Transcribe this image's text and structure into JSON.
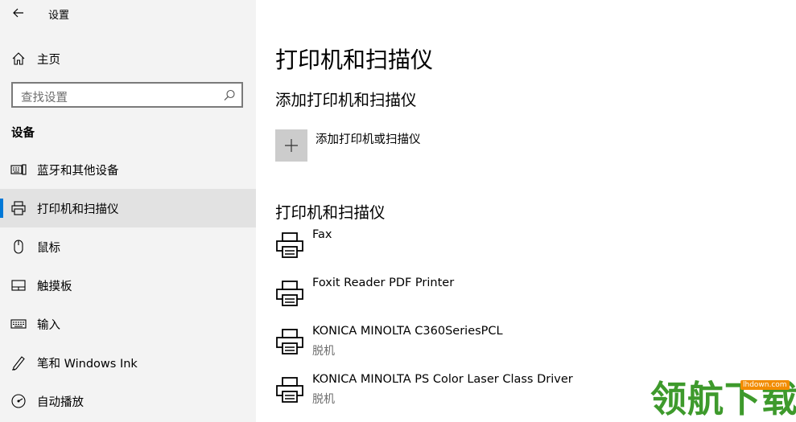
{
  "window": {
    "title": "设置"
  },
  "sidebar": {
    "home_label": "主页",
    "search_placeholder": "查找设置",
    "section_label": "设备",
    "items": [
      {
        "label": "蓝牙和其他设备",
        "icon": "bluetooth-devices-icon"
      },
      {
        "label": "打印机和扫描仪",
        "icon": "printer-icon",
        "active": true
      },
      {
        "label": "鼠标",
        "icon": "mouse-icon"
      },
      {
        "label": "触摸板",
        "icon": "touchpad-icon"
      },
      {
        "label": "输入",
        "icon": "keyboard-icon"
      },
      {
        "label": "笔和 Windows Ink",
        "icon": "pen-icon"
      },
      {
        "label": "自动播放",
        "icon": "autoplay-icon"
      }
    ]
  },
  "main": {
    "title": "打印机和扫描仪",
    "add_section_heading": "添加打印机和扫描仪",
    "add_button_label": "添加打印机或扫描仪",
    "list_heading": "打印机和扫描仪",
    "printers": [
      {
        "name": "Fax",
        "status": ""
      },
      {
        "name": "Foxit Reader PDF Printer",
        "status": ""
      },
      {
        "name": "KONICA MINOLTA C360SeriesPCL",
        "status": "脱机"
      },
      {
        "name": "KONICA MINOLTA PS Color Laser Class Driver",
        "status": "脱机"
      }
    ]
  },
  "watermark": {
    "text": "领航下载",
    "url": "lhdown.com"
  },
  "colors": {
    "accent": "#0078d7",
    "sidebar_bg": "#f3f3f3",
    "active_bg": "#e2e2e2",
    "watermark_green": "#3e9a2c"
  }
}
